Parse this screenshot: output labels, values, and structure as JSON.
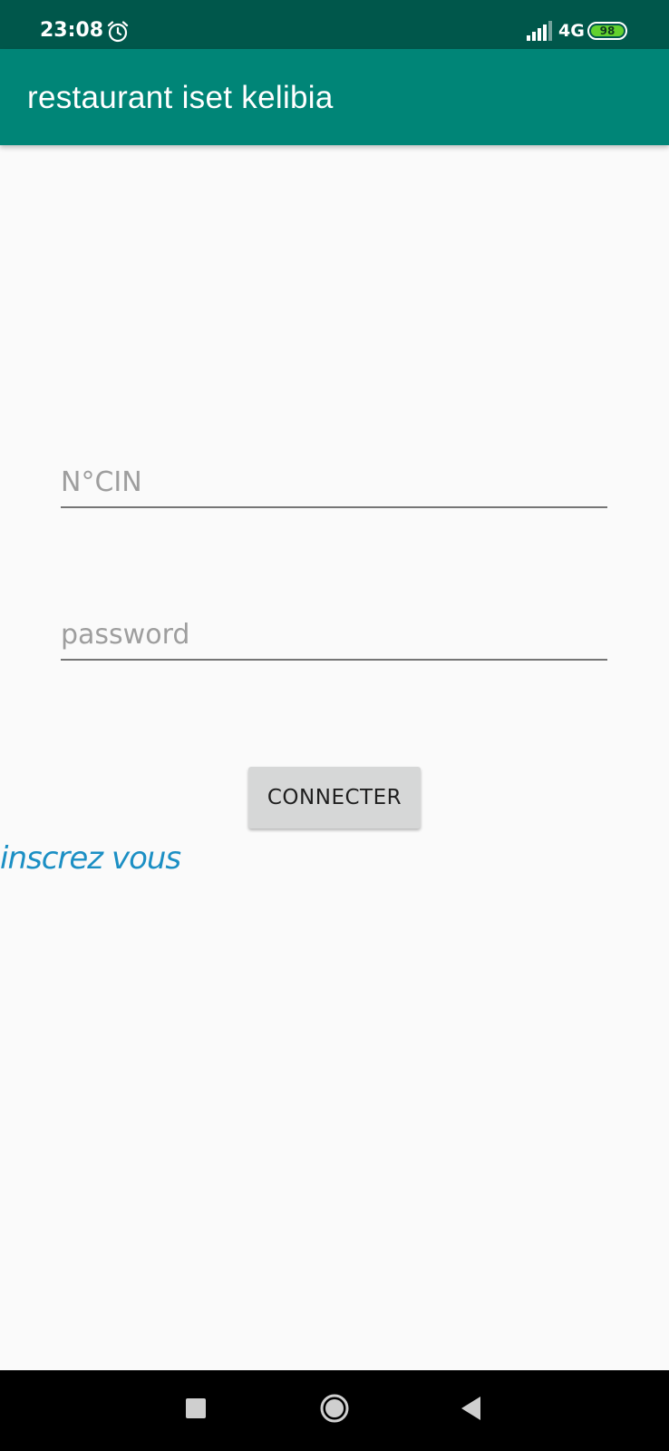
{
  "status_bar": {
    "time": "23:08",
    "network": "4G",
    "battery": "98",
    "icons": [
      "alarm-icon",
      "signal-icon",
      "battery-icon"
    ]
  },
  "app_bar": {
    "title": "restaurant iset kelibia"
  },
  "login_form": {
    "cin_placeholder": "N°CIN",
    "password_placeholder": "password",
    "connect_label": "CONNECTER",
    "register_link": "inscrez vous"
  },
  "nav_bar": {
    "icons": [
      "recents-icon",
      "home-icon",
      "back-icon"
    ]
  },
  "colors": {
    "status_bar": "#00574b",
    "app_bar": "#008577",
    "background": "#fafafa",
    "button": "#d6d7d7",
    "link": "#1b8fc4",
    "battery_fill": "#62d12e"
  }
}
